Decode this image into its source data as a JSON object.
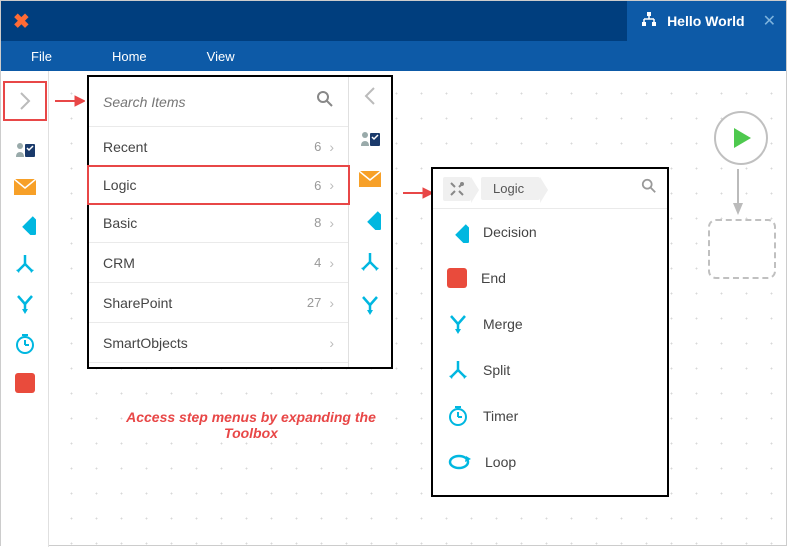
{
  "titlebar": {
    "doc_label": "Hello World"
  },
  "ribbon": {
    "file": "File",
    "home": "Home",
    "view": "View"
  },
  "panel": {
    "search_placeholder": "Search Items",
    "cats": [
      {
        "name": "Recent",
        "count": "6"
      },
      {
        "name": "Logic",
        "count": "6"
      },
      {
        "name": "Basic",
        "count": "8"
      },
      {
        "name": "CRM",
        "count": "4"
      },
      {
        "name": "SharePoint",
        "count": "27"
      },
      {
        "name": "SmartObjects",
        "count": ""
      }
    ]
  },
  "logic": {
    "breadcrumb": "Logic",
    "items": [
      "Decision",
      "End",
      "Merge",
      "Split",
      "Timer",
      "Loop"
    ]
  },
  "annotation": "Access step menus by expanding the Toolbox"
}
